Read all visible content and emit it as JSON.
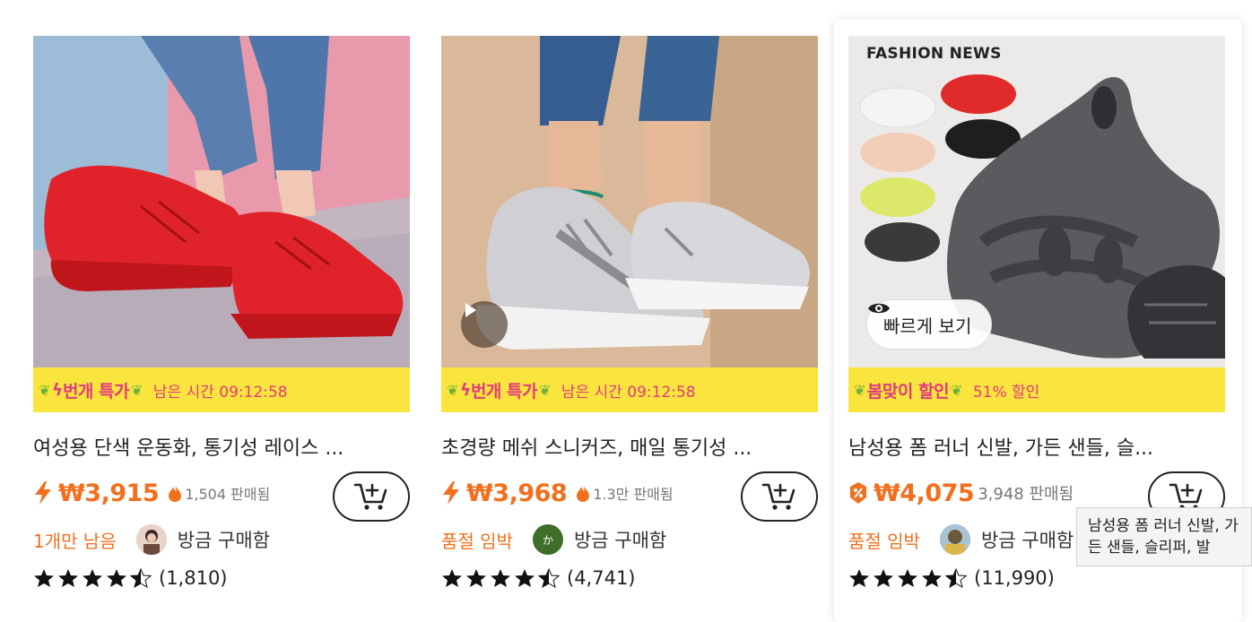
{
  "colors": {
    "accent": "#f0701e",
    "promo_bg": "#f9e53d",
    "promo_text": "#e23b7c"
  },
  "products": [
    {
      "title": "여성용 단색 운동화, 통기성 레이스 ...",
      "promo_tag": "번개 특가",
      "promo_info": "남은 시간 09:12:58",
      "price_icon": "lightning-icon",
      "price": "₩3,915",
      "sold_icon": "fire-icon",
      "sold": "1,504 판매됨",
      "stock": "1개만 남음",
      "buyer_text": "방금 구매함",
      "avatar_label": "",
      "rating": 4.5,
      "review_count": "(1,810)"
    },
    {
      "title": "초경량 메쉬 스니커즈, 매일 통기성 ...",
      "promo_tag": "번개 특가",
      "promo_info": "남은 시간 09:12:58",
      "price_icon": "lightning-icon",
      "price": "₩3,968",
      "sold_icon": "fire-icon",
      "sold": "1.3만 판매됨",
      "stock": "품절 임박",
      "buyer_text": "방금 구매함",
      "avatar_label": "か",
      "rating": 4.5,
      "review_count": "(4,741)"
    },
    {
      "title": "남성용 폼 러너 신발, 가든 샌들, 슬...",
      "promo_tag": "봄맞이 할인",
      "promo_info": "51% 할인",
      "price_icon": "discount-tag-icon",
      "price": "₩4,075",
      "sold_icon": "",
      "sold": "3,948 판매됨",
      "stock": "품절 임박",
      "buyer_text": "방금 구매함",
      "avatar_label": "",
      "rating": 4.5,
      "review_count": "(11,990)",
      "image_label": "FASHION NEWS",
      "quick_view": "빠르게 보기"
    }
  ],
  "tooltip": "남성용 폼 러너 신발, 가든 샌들, 슬리퍼, 발"
}
